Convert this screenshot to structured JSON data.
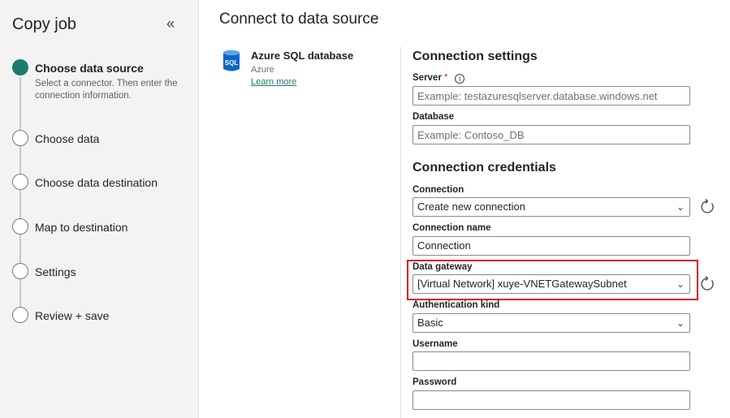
{
  "sidebar": {
    "title": "Copy job",
    "collapse_icon": "«",
    "steps": [
      {
        "label": "Choose data source",
        "description": "Select a connector. Then enter the connection information.",
        "active": true
      },
      {
        "label": "Choose data",
        "active": false
      },
      {
        "label": "Choose data destination",
        "active": false
      },
      {
        "label": "Map to destination",
        "active": false
      },
      {
        "label": "Settings",
        "active": false
      },
      {
        "label": "Review + save",
        "active": false
      }
    ]
  },
  "main": {
    "title": "Connect to data source",
    "connector": {
      "icon_text": "SQL",
      "name": "Azure SQL database",
      "subtitle": "Azure",
      "link": "Learn more"
    },
    "connection_settings": {
      "heading": "Connection settings",
      "server_label": "Server",
      "server_required": "*",
      "server_placeholder": "Example: testazuresqlserver.database.windows.net",
      "database_label": "Database",
      "database_placeholder": "Example: Contoso_DB"
    },
    "connection_credentials": {
      "heading": "Connection credentials",
      "connection_label": "Connection",
      "connection_value": "Create new connection",
      "connection_name_label": "Connection name",
      "connection_name_value": "Connection",
      "gateway_label": "Data gateway",
      "gateway_value": "[Virtual Network] xuye-VNETGatewaySubnet",
      "auth_label": "Authentication kind",
      "auth_value": "Basic",
      "username_label": "Username",
      "username_value": "",
      "password_label": "Password",
      "password_value": ""
    }
  },
  "colors": {
    "accent": "#1f7a6e",
    "highlight": "#e0141e",
    "required": "#c4314b"
  }
}
